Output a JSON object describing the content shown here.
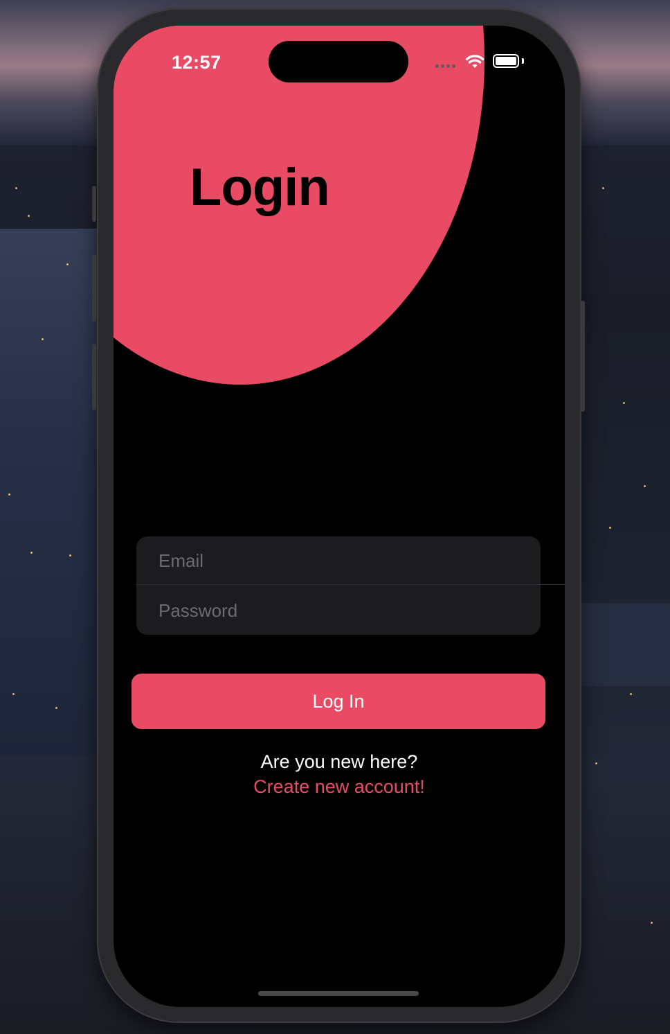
{
  "status_bar": {
    "time": "12:57",
    "icons": [
      "cellular-signal-icon",
      "wifi-icon",
      "battery-icon"
    ]
  },
  "header": {
    "title": "Login"
  },
  "form": {
    "email_placeholder": "Email",
    "email_value": "",
    "password_placeholder": "Password",
    "password_value": ""
  },
  "actions": {
    "login_label": "Log In",
    "new_user_prompt": "Are you new here?",
    "create_account_label": "Create new account!"
  },
  "colors": {
    "accent": "#e94b64",
    "background": "#000000",
    "field_background": "#1c1c1e",
    "placeholder": "#6c6c70",
    "text": "#ffffff"
  }
}
